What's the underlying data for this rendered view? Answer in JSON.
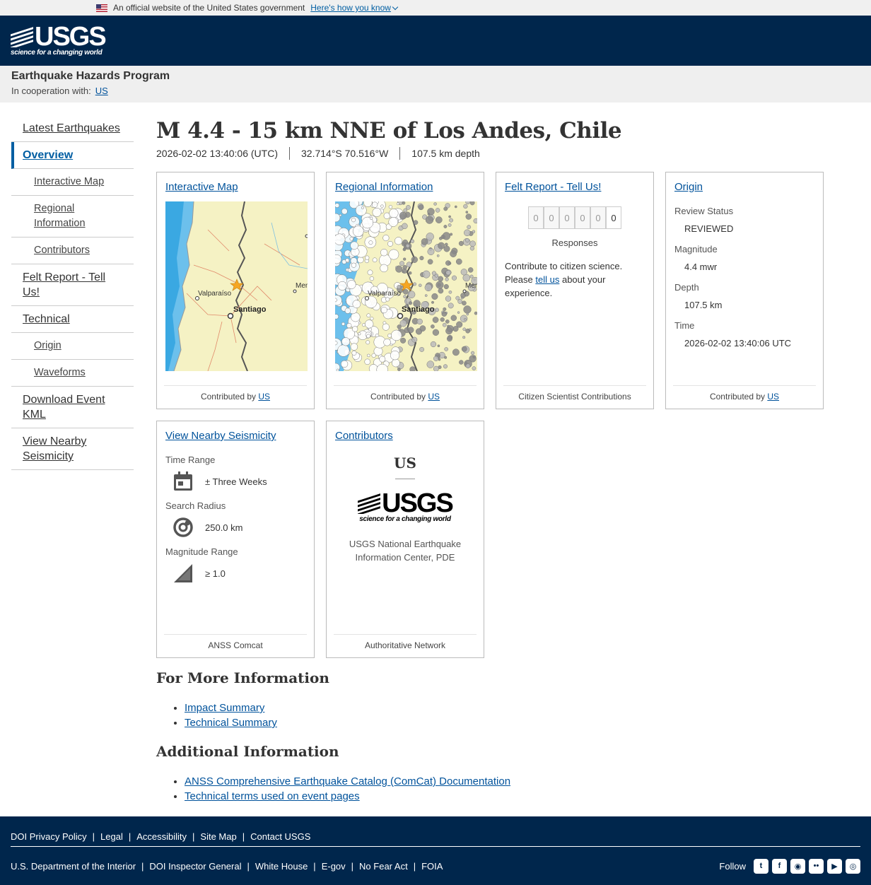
{
  "gov_banner": {
    "text": "An official website of the United States government",
    "link": "Here's how you know"
  },
  "header": {
    "logo_word": "USGS",
    "logo_tagline": "science for a changing world"
  },
  "program": {
    "title": "Earthquake Hazards Program",
    "coop_label": "In cooperation with:",
    "coop_link": "US"
  },
  "sidenav": {
    "items": [
      {
        "label": "Latest Earthquakes"
      },
      {
        "label": "Overview"
      },
      {
        "label": "Interactive Map"
      },
      {
        "label": "Regional Information"
      },
      {
        "label": "Contributors"
      },
      {
        "label": "Felt Report - Tell Us!"
      },
      {
        "label": "Technical"
      },
      {
        "label": "Origin"
      },
      {
        "label": "Waveforms"
      },
      {
        "label": "Download Event KML"
      },
      {
        "label": "View Nearby Seismicity"
      }
    ]
  },
  "event": {
    "title": "M 4.4 - 15 km NNE of Los Andes, Chile",
    "time": "2026-02-02 13:40:06 (UTC)",
    "location": "32.714°S 70.516°W",
    "depth": "107.5 km depth"
  },
  "cards": {
    "interactive_map": {
      "link": "Interactive Map",
      "labels": {
        "valparaiso": "Valparaíso",
        "santiago": "Santiago",
        "men": "Men"
      },
      "footer_prefix": "Contributed by",
      "footer_link": "US"
    },
    "regional": {
      "link": "Regional Information",
      "labels": {
        "valparaiso": "Valparaíso",
        "santiago": "Santiago",
        "men": "Men"
      },
      "footer_prefix": "Contributed by",
      "footer_link": "US"
    },
    "felt": {
      "link": "Felt Report - Tell Us!",
      "digits": [
        "0",
        "0",
        "0",
        "0",
        "0",
        "0"
      ],
      "responses": "Responses",
      "text_before": "Contribute to citizen science. Please",
      "text_link": "tell us",
      "text_after": "about your experience.",
      "footer": "Citizen Scientist Contributions"
    },
    "origin": {
      "link": "Origin",
      "fields": [
        {
          "label": "Review Status",
          "value": "REVIEWED"
        },
        {
          "label": "Magnitude",
          "value": "4.4 mwr"
        },
        {
          "label": "Depth",
          "value": "107.5 km"
        },
        {
          "label": "Time",
          "value": "2026-02-02 13:40:06 UTC"
        }
      ],
      "footer_prefix": "Contributed by",
      "footer_link": "US"
    },
    "seismicity": {
      "link": "View Nearby Seismicity",
      "time_label": "Time Range",
      "time_value": "± Three Weeks",
      "radius_label": "Search Radius",
      "radius_value": "250.0 km",
      "mag_label": "Magnitude Range",
      "mag_value": "≥ 1.0",
      "footer": "ANSS Comcat"
    },
    "contributors": {
      "link": "Contributors",
      "code": "US",
      "logo_word": "USGS",
      "logo_tagline": "science for a changing world",
      "name": "USGS National Earthquake Information Center, PDE",
      "footer": "Authoritative Network"
    }
  },
  "more_info": {
    "heading": "For More Information",
    "links": [
      "Impact Summary",
      "Technical Summary"
    ]
  },
  "additional_info": {
    "heading": "Additional Information",
    "links": [
      "ANSS Comprehensive Earthquake Catalog (ComCat) Documentation",
      "Technical terms used on event pages"
    ]
  },
  "footer": {
    "top_links": [
      "DOI Privacy Policy",
      "Legal",
      "Accessibility",
      "Site Map",
      "Contact USGS"
    ],
    "bottom_links": [
      "U.S. Department of the Interior",
      "DOI Inspector General",
      "White House",
      "E-gov",
      "No Fear Act",
      "FOIA"
    ],
    "follow": "Follow",
    "social_icons": [
      "twitter-icon",
      "facebook-icon",
      "github-icon",
      "flickr-icon",
      "youtube-icon",
      "instagram-icon"
    ]
  },
  "colors": {
    "header_bg": "#00264c",
    "link": "#00529b",
    "active_nav": "#005ea2",
    "star": "#f6a623"
  }
}
